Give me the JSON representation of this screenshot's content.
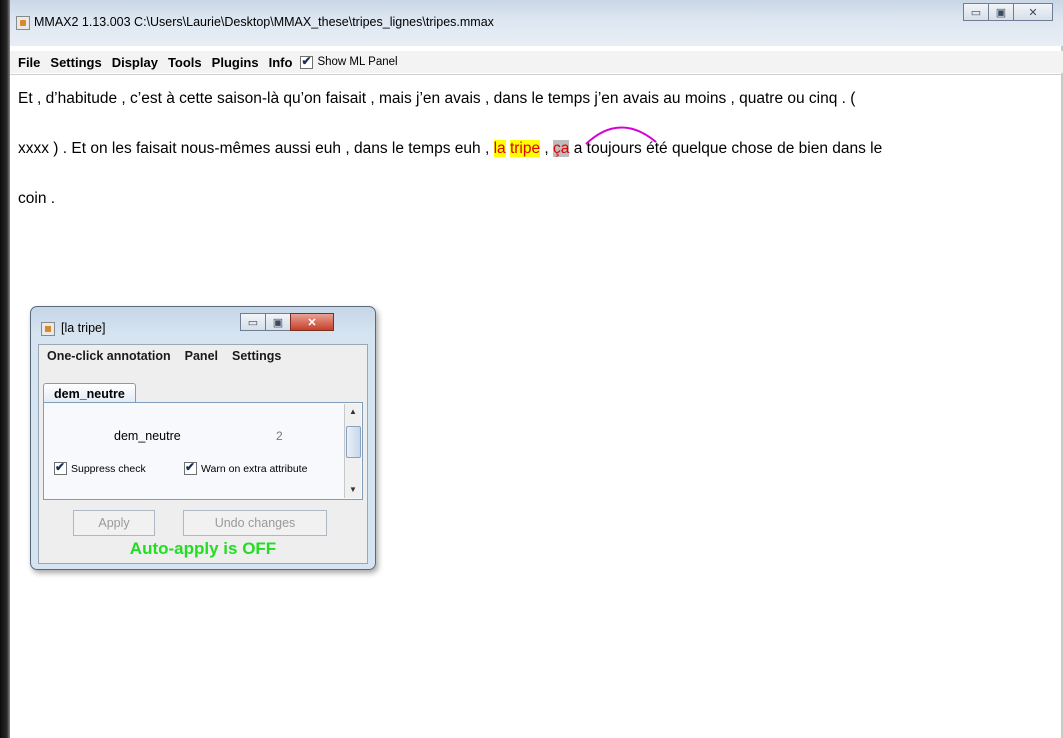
{
  "window": {
    "title": "MMAX2 1.13.003 C:\\Users\\Laurie\\Desktop\\MMAX_these\\tripes_lignes\\tripes.mmax",
    "controls": {
      "minimize": "▭",
      "maximize": "▣",
      "close": "✕"
    }
  },
  "menubar": {
    "items": [
      "File",
      "Settings",
      "Display",
      "Tools",
      "Plugins",
      "Info"
    ],
    "show_ml_panel": {
      "label": "Show ML Panel",
      "checked": true
    }
  },
  "document": {
    "line1": "Et , d’habitude , c’est à cette saison-là qu’on faisait , mais j’en avais , dans le temps j’en avais au moins , quatre ou cinq . (",
    "line2_before": "xxxx ) . Et on les faisait nous-mêmes aussi euh , dans le temps euh , ",
    "markable_la": "la",
    "markable_tripe": "tripe",
    "sep": " , ",
    "markable_ca": "ça",
    "line2_after": " a toujours été quelque chose de bien dans le",
    "line3": "coin ."
  },
  "annotation_window": {
    "title": "[la tripe]",
    "menu": [
      "One-click annotation",
      "Panel",
      "Settings"
    ],
    "tab": "dem_neutre",
    "attribute_name": "dem_neutre",
    "attribute_value": "2",
    "suppress_check": {
      "label": "Suppress check",
      "checked": true
    },
    "warn_extra": {
      "label": "Warn on extra attribute",
      "checked": true
    },
    "apply_button": "Apply",
    "undo_button": "Undo changes",
    "auto_apply_status": "Auto-apply is OFF"
  },
  "colors": {
    "markable_highlight": "#ffff00",
    "markable_text": "#e00000",
    "relation_arc": "#d400d4",
    "auto_apply_text": "#22dd22"
  }
}
